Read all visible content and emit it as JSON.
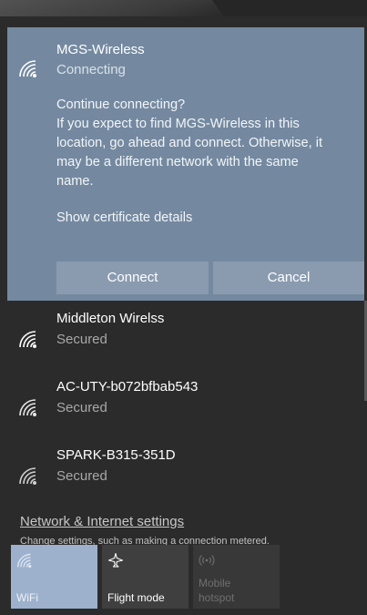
{
  "expanded_network": {
    "name": "MGS-Wireless",
    "status": "Connecting",
    "prompt_lines": [
      "Continue connecting?",
      "If you expect to find MGS-Wireless in this",
      "location, go ahead and connect. Otherwise, it",
      "may be a different network with the same",
      "name."
    ],
    "certificate_link": "Show certificate details",
    "connect_label": "Connect",
    "cancel_label": "Cancel"
  },
  "networks": [
    {
      "name": "Middleton Wirelss",
      "status": "Secured"
    },
    {
      "name": "AC-UTY-b072bfbab543",
      "status": "Secured"
    },
    {
      "name": "SPARK-B315-351D",
      "status": "Secured"
    }
  ],
  "settings": {
    "link_label": "Network & Internet settings",
    "description": "Change settings, such as making a connection metered."
  },
  "quick_actions": {
    "wifi": {
      "label": "WiFi",
      "icon": "wifi-icon",
      "active": true
    },
    "flight": {
      "label": "Flight mode",
      "icon": "airplane-icon",
      "active": false
    },
    "hotspot": {
      "label_line1": "Mobile",
      "label_line2": "hotspot",
      "icon": "hotspot-icon",
      "active": false
    }
  },
  "colors": {
    "expanded_background": "#7489a0",
    "button_background": "#8a9bb0",
    "wifi_tile_active": "#9db1cd",
    "panel_background": "#2b2b2b"
  }
}
